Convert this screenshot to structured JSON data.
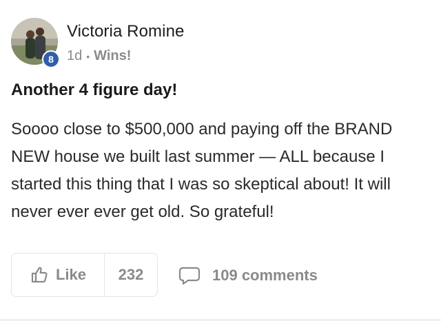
{
  "post": {
    "author": {
      "name": "Victoria Romine",
      "level": "8"
    },
    "meta": {
      "time": "1d",
      "separator": "•",
      "category": "Wins!"
    },
    "title": "Another 4 figure day!",
    "body": "Soooo close to $500,000 and paying off the BRAND NEW house we built last summer — ALL because I started this thing that I was so skeptical about! It will never ever ever get old. So grateful!"
  },
  "actions": {
    "like_label": "Like",
    "like_count": "232",
    "comments_label": "109 comments"
  },
  "icons": {
    "like": "thumbs-up-icon",
    "comments": "speech-bubble-icon"
  },
  "colors": {
    "badge": "#2f5fa8",
    "muted_text": "#8a8a8a",
    "border": "#e4e4e4"
  }
}
